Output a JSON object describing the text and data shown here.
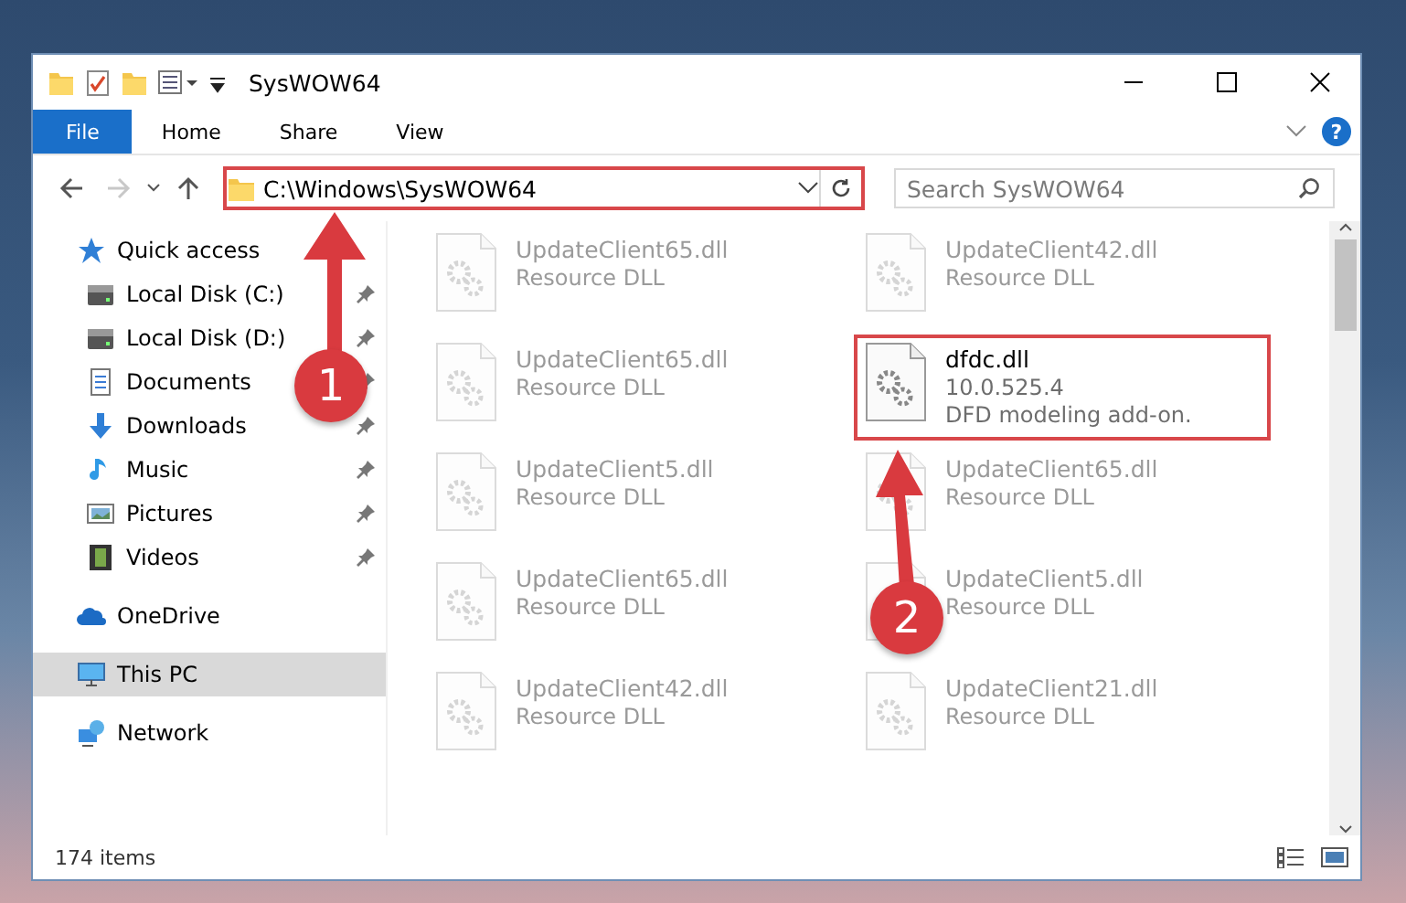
{
  "window": {
    "title": "SysWOW64"
  },
  "ribbon": {
    "tabs": [
      {
        "label": "File",
        "selected": true
      },
      {
        "label": "Home",
        "selected": false
      },
      {
        "label": "Share",
        "selected": false
      },
      {
        "label": "View",
        "selected": false
      }
    ],
    "help_label": "?"
  },
  "address_bar": {
    "path": "C:\\Windows\\SysWOW64",
    "highlighted": true
  },
  "search": {
    "placeholder": "Search SysWOW64"
  },
  "sidebar": {
    "items": [
      {
        "label": "Quick access",
        "kind": "star",
        "selected": false,
        "children": [
          {
            "label": "Local Disk (C:)",
            "kind": "disk",
            "pinned": true
          },
          {
            "label": "Local Disk (D:)",
            "kind": "disk",
            "pinned": true
          },
          {
            "label": "Documents",
            "kind": "document",
            "pinned": true
          },
          {
            "label": "Downloads",
            "kind": "download",
            "pinned": true
          },
          {
            "label": "Music",
            "kind": "music",
            "pinned": true
          },
          {
            "label": "Pictures",
            "kind": "picture",
            "pinned": true
          },
          {
            "label": "Videos",
            "kind": "video",
            "pinned": true
          }
        ]
      },
      {
        "label": "OneDrive",
        "kind": "cloud",
        "selected": false
      },
      {
        "label": "This PC",
        "kind": "computer",
        "selected": true
      },
      {
        "label": "Network",
        "kind": "network",
        "selected": false
      }
    ]
  },
  "files": [
    {
      "name": "UpdateClient65.dll",
      "lines": [
        "Resource DLL"
      ],
      "blurred": true,
      "highlighted": false
    },
    {
      "name": "UpdateClient42.dll",
      "lines": [
        "Resource DLL"
      ],
      "blurred": true,
      "highlighted": false
    },
    {
      "name": "UpdateClient65.dll",
      "lines": [
        "Resource DLL"
      ],
      "blurred": true,
      "highlighted": false
    },
    {
      "name": "dfdc.dll",
      "lines": [
        "10.0.525.4",
        "DFD modeling add-on."
      ],
      "blurred": false,
      "highlighted": true
    },
    {
      "name": "UpdateClient5.dll",
      "lines": [
        "Resource DLL"
      ],
      "blurred": true,
      "highlighted": false
    },
    {
      "name": "UpdateClient65.dll",
      "lines": [
        "Resource DLL"
      ],
      "blurred": true,
      "highlighted": false
    },
    {
      "name": "UpdateClient65.dll",
      "lines": [
        "Resource DLL"
      ],
      "blurred": true,
      "highlighted": false
    },
    {
      "name": "UpdateClient5.dll",
      "lines": [
        "Resource DLL"
      ],
      "blurred": true,
      "highlighted": false
    },
    {
      "name": "UpdateClient42.dll",
      "lines": [
        "Resource DLL"
      ],
      "blurred": true,
      "highlighted": false
    },
    {
      "name": "UpdateClient21.dll",
      "lines": [
        "Resource DLL"
      ],
      "blurred": true,
      "highlighted": false
    }
  ],
  "status_bar": {
    "item_count": "174 items"
  },
  "annotations": [
    {
      "number": "1"
    },
    {
      "number": "2"
    }
  ]
}
